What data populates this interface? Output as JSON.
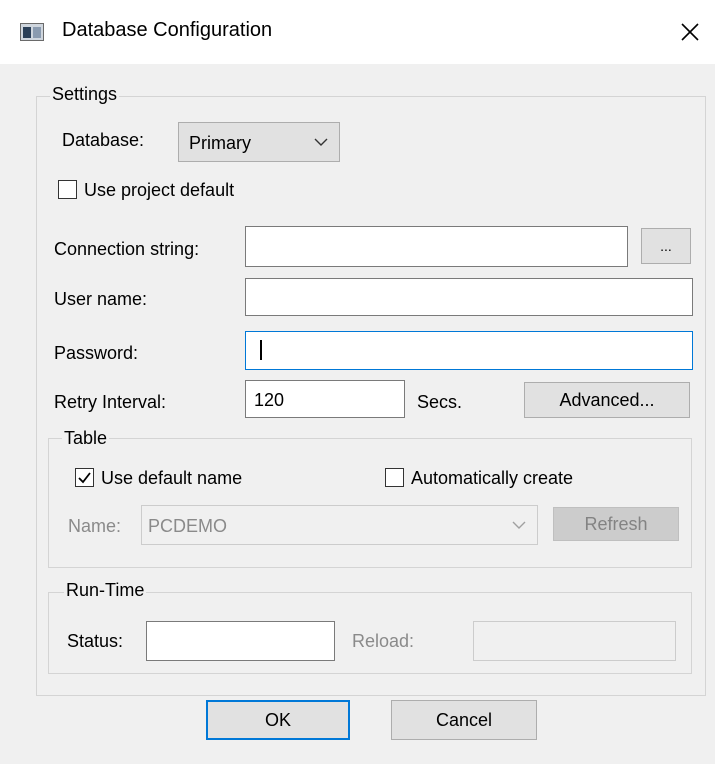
{
  "window": {
    "title": "Database Configuration",
    "close_icon": "close-icon"
  },
  "settings": {
    "group_label": "Settings",
    "database_label": "Database:",
    "database_value": "Primary",
    "use_project_default_label": "Use project default",
    "use_project_default_checked": false,
    "connection_string_label": "Connection string:",
    "connection_string_value": "",
    "browse_label": "...",
    "user_name_label": "User name:",
    "user_name_value": "",
    "password_label": "Password:",
    "password_value": "",
    "retry_interval_label": "Retry Interval:",
    "retry_interval_value": "120",
    "secs_label": "Secs.",
    "advanced_label": "Advanced..."
  },
  "table": {
    "group_label": "Table",
    "use_default_name_label": "Use default name",
    "use_default_name_checked": true,
    "auto_create_label": "Automatically create",
    "auto_create_checked": false,
    "name_label": "Name:",
    "name_value": "PCDEMO",
    "refresh_label": "Refresh"
  },
  "runtime": {
    "group_label": "Run-Time",
    "status_label": "Status:",
    "status_value": "",
    "reload_label": "Reload:",
    "reload_value": ""
  },
  "footer": {
    "ok_label": "OK",
    "cancel_label": "Cancel"
  },
  "colors": {
    "focus_border": "#0078d7",
    "button_face": "#e1e1e1",
    "dialog_bg": "#f0f0f0"
  }
}
